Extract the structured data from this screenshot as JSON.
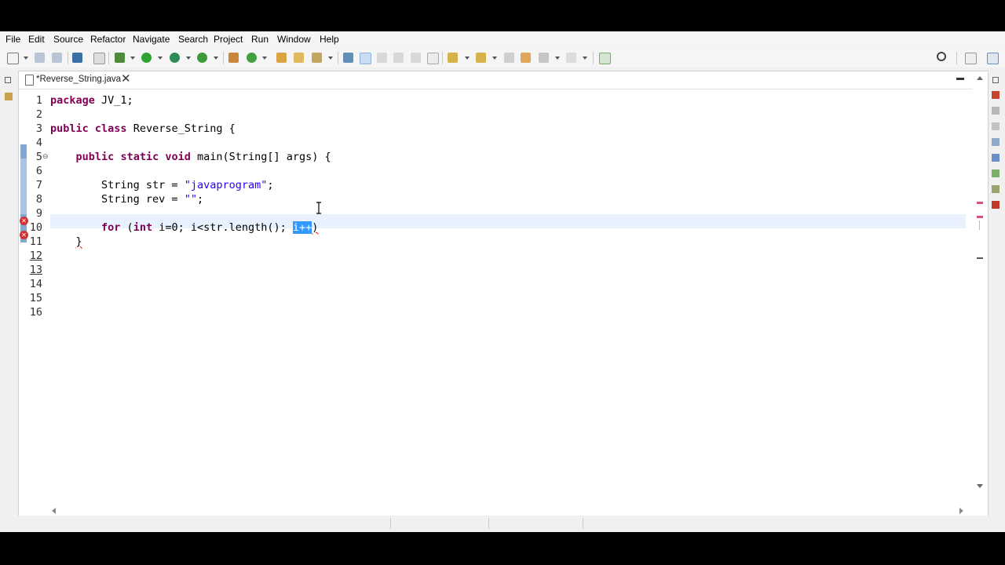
{
  "menu": [
    "File",
    "Edit",
    "Source",
    "Refactor",
    "Navigate",
    "Search",
    "Project",
    "Run",
    "Window",
    "Help"
  ],
  "editor_tab": {
    "label": "*Reverse_String.java",
    "close_glyph": "✕"
  },
  "code": {
    "line_numbers": [
      "1",
      "2",
      "3",
      "4",
      "5",
      "6",
      "7",
      "8",
      "9",
      "10",
      "11",
      "12",
      "13",
      "14",
      "15",
      "16"
    ],
    "lines": {
      "l1_kw": "package",
      "l1_rest": " JV_1;",
      "l3_kw1": "public",
      "l3_kw2": "class",
      "l3_rest": " Reverse_String {",
      "l5_kw1": "public",
      "l5_kw2": "static",
      "l5_kw3": "void",
      "l5_rest": " main(String[] args) {",
      "l7_pre": "String str = ",
      "l7_str": "\"javaprogram\"",
      "l7_post": ";",
      "l8_pre": "String rev = ",
      "l8_str": "\"\"",
      "l8_post": ";",
      "l10_kw1": "for",
      "l10_mid1": " (",
      "l10_kw2": "int",
      "l10_mid2": " i=0; i<str.length(); ",
      "l10_sel": "i++",
      "l10_post": ")",
      "l11": "}"
    },
    "error_lines": [
      "10",
      "11"
    ],
    "changed_lines": [
      "5",
      "8",
      "10",
      "11"
    ],
    "current_line": "10",
    "selected_text": "i++"
  },
  "colors": {
    "keyword": "#7f0055",
    "string": "#2a00ff",
    "selection": "#3399ff",
    "current_line": "#e8f2fe",
    "error": "#d63131",
    "change_bar": "#7fa8d2"
  }
}
